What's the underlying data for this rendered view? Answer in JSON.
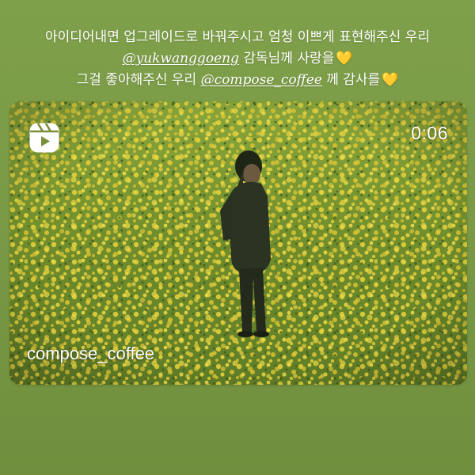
{
  "caption": {
    "line1": "아이디어내면 업그레이드로 바꿔주시고 엄청 이쁘게 표현해주신 우리",
    "line2_mention": "@yukwanggoeng",
    "line2_text": " 감독님께 사랑을",
    "line3_text": "그걸 좋아해주신 우리 ",
    "line3_mention": "@compose_coffee",
    "line3_text2": " 께 감사를",
    "heart_icon": "yellow-heart-icon",
    "heart_glyph": "💛"
  },
  "reel": {
    "icon": "reels-icon",
    "duration": "0:06",
    "username": "compose_coffee"
  },
  "colors": {
    "background": "#7a9a46",
    "text": "#ffffff",
    "heart": "#ffcf3a",
    "field": "#6b8a2e",
    "flowers": "#e7d13a"
  }
}
